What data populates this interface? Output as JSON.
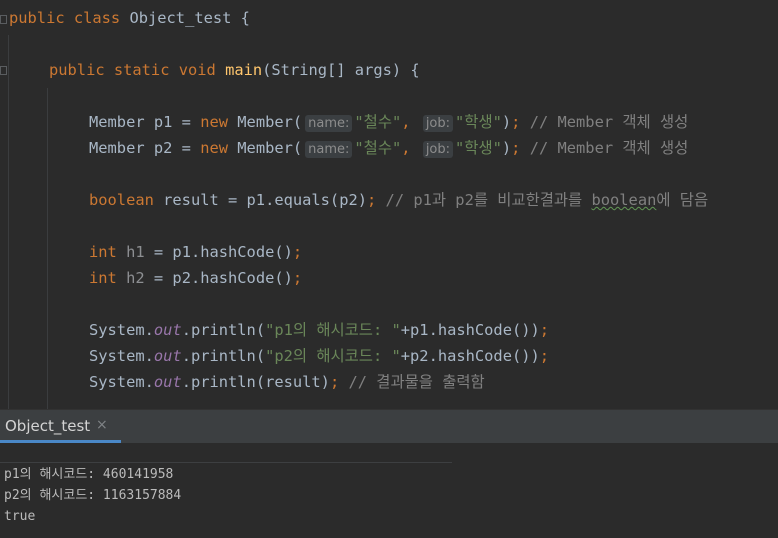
{
  "editor": {
    "lines": [
      {
        "t0": "public class ",
        "t1": "Object_test {"
      },
      {
        "kw": "public static void ",
        "fn": "main",
        "rest": "(String[] args) {"
      },
      {
        "pre": "Member p1 = ",
        "kw": "new ",
        "mid": "Member(",
        "hint1": "name:",
        "s1": "\"철수\"",
        "c1": ", ",
        "hint2": "job:",
        "s2": "\"학생\"",
        "end": ")",
        "semi": ";",
        "cmt": " // Member 객체 생성"
      },
      {
        "pre": "Member p2 = ",
        "kw": "new ",
        "mid": "Member(",
        "hint1": "name:",
        "s1": "\"철수\"",
        "c1": ", ",
        "hint2": "job:",
        "s2": "\"학생\"",
        "end": ")",
        "semi": ";",
        "cmt": " // Member 객체 생성"
      },
      {
        "kw": "boolean ",
        "mid": "result = p1.equals(p2)",
        "semi": ";",
        "cmt1": " // p1과 p2를 비교한결과를 ",
        "wavy": "boolean",
        "cmt2": "에 담음"
      },
      {
        "kw": "int ",
        "var": "h1",
        "mid": " = p1.hashCode()",
        "semi": ";"
      },
      {
        "kw": "int ",
        "var": "h2",
        "mid": " = p2.hashCode()",
        "semi": ";"
      },
      {
        "pre": "System.",
        "fld": "out",
        "mid": ".println(",
        "str": "\"p1의 해시코드: \"",
        "rest": "+p1.hashCode())",
        "semi": ";"
      },
      {
        "pre": "System.",
        "fld": "out",
        "mid": ".println(",
        "str": "\"p2의 해시코드: \"",
        "rest": "+p2.hashCode())",
        "semi": ";"
      },
      {
        "pre": "System.",
        "fld": "out",
        "mid": ".println(result)",
        "semi": ";",
        "cmt": " // 결과물을 출력함"
      }
    ]
  },
  "run_panel": {
    "tab_label": "Object_test",
    "close_symbol": "×",
    "output": [
      "p1의 해시코드: 460141958",
      "p2의 해시코드: 1163157884",
      "true"
    ]
  }
}
